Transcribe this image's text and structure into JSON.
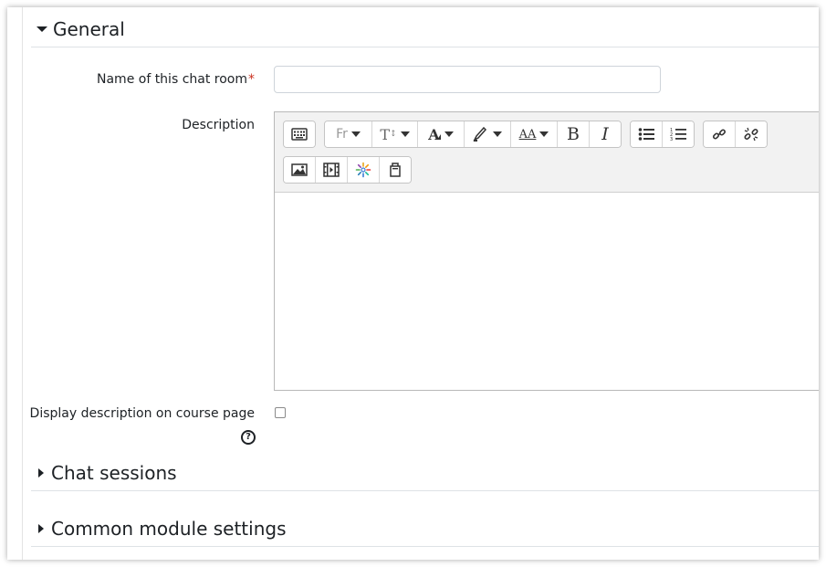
{
  "sections": {
    "general": {
      "title": "General",
      "expanded": true
    },
    "chat_sessions": {
      "title": "Chat sessions",
      "expanded": false
    },
    "common_module_settings": {
      "title": "Common module settings",
      "expanded": false
    }
  },
  "fields": {
    "name": {
      "label": "Name of this chat room",
      "required_marker": "*",
      "value": "",
      "placeholder": ""
    },
    "description": {
      "label": "Description",
      "value": ""
    },
    "display_description": {
      "label": "Display description on course page",
      "checked": false,
      "help_symbol": "?"
    }
  },
  "editor_toolbar": {
    "row1": [
      {
        "name": "show-more-buttons",
        "icon": "keyboard-icon"
      },
      {
        "name": "font-family",
        "label": "Fr",
        "icon": "font-family-icon",
        "dropdown": true
      },
      {
        "name": "font-size",
        "label": "T",
        "icon": "font-size-icon",
        "dropdown": true
      },
      {
        "name": "font-color",
        "label": "A",
        "icon": "font-color-icon",
        "dropdown": true
      },
      {
        "name": "background-color",
        "icon": "highlighter-icon",
        "dropdown": true
      },
      {
        "name": "paragraph-styles",
        "label": "AA",
        "icon": "paragraph-styles-icon",
        "dropdown": true
      },
      {
        "name": "bold",
        "label": "B",
        "icon": "bold-icon"
      },
      {
        "name": "italic",
        "label": "I",
        "icon": "italic-icon"
      },
      {
        "name": "unordered-list",
        "icon": "unordered-list-icon"
      },
      {
        "name": "ordered-list",
        "icon": "ordered-list-icon"
      },
      {
        "name": "link",
        "icon": "link-icon"
      },
      {
        "name": "unlink",
        "icon": "unlink-icon"
      }
    ],
    "row2": [
      {
        "name": "image",
        "icon": "image-icon"
      },
      {
        "name": "media",
        "icon": "film-icon"
      },
      {
        "name": "h5p",
        "icon": "h5p-burst-icon"
      },
      {
        "name": "manage-files",
        "icon": "files-icon"
      }
    ]
  },
  "colors": {
    "required": "#ca3120",
    "toolbar_bg": "#f2f2f2",
    "text": "#1d2125"
  }
}
